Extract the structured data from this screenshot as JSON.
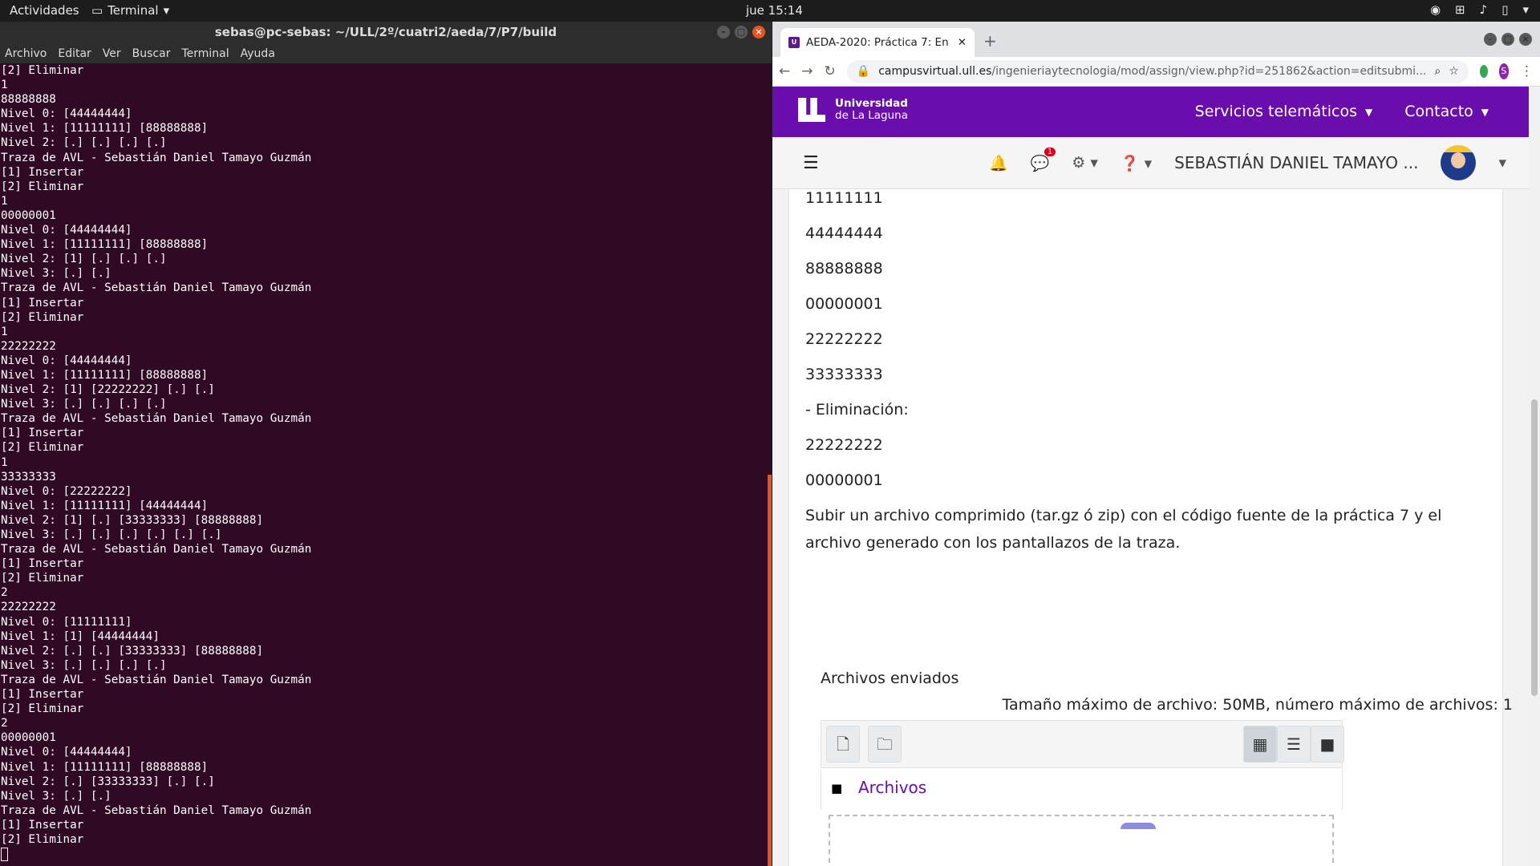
{
  "topbar": {
    "activities": "Actividades",
    "app_name": "Terminal",
    "clock": "jue 15:14"
  },
  "terminal": {
    "title": "sebas@pc-sebas: ~/ULL/2º/cuatri2/aeda/7/P7/build",
    "menu": [
      "Archivo",
      "Editar",
      "Ver",
      "Buscar",
      "Terminal",
      "Ayuda"
    ],
    "lines": [
      "[2] Eliminar",
      "1",
      "88888888",
      "Nivel 0: [44444444]",
      "Nivel 1: [11111111] [88888888]",
      "Nivel 2: [.] [.] [.] [.]",
      "Traza de AVL - Sebastián Daniel Tamayo Guzmán",
      "[1] Insertar",
      "[2] Eliminar",
      "1",
      "00000001",
      "Nivel 0: [44444444]",
      "Nivel 1: [11111111] [88888888]",
      "Nivel 2: [1] [.] [.] [.]",
      "Nivel 3: [.] [.]",
      "Traza de AVL - Sebastián Daniel Tamayo Guzmán",
      "[1] Insertar",
      "[2] Eliminar",
      "1",
      "22222222",
      "Nivel 0: [44444444]",
      "Nivel 1: [11111111] [88888888]",
      "Nivel 2: [1] [22222222] [.] [.]",
      "Nivel 3: [.] [.] [.] [.]",
      "Traza de AVL - Sebastián Daniel Tamayo Guzmán",
      "[1] Insertar",
      "[2] Eliminar",
      "1",
      "33333333",
      "Nivel 0: [22222222]",
      "Nivel 1: [11111111] [44444444]",
      "Nivel 2: [1] [.] [33333333] [88888888]",
      "Nivel 3: [.] [.] [.] [.] [.] [.]",
      "Traza de AVL - Sebastián Daniel Tamayo Guzmán",
      "[1] Insertar",
      "[2] Eliminar",
      "2",
      "22222222",
      "Nivel 0: [11111111]",
      "Nivel 1: [1] [44444444]",
      "Nivel 2: [.] [.] [33333333] [88888888]",
      "Nivel 3: [.] [.] [.] [.]",
      "Traza de AVL - Sebastián Daniel Tamayo Guzmán",
      "[1] Insertar",
      "[2] Eliminar",
      "2",
      "00000001",
      "Nivel 0: [44444444]",
      "Nivel 1: [11111111] [88888888]",
      "Nivel 2: [.] [33333333] [.] [.]",
      "Nivel 3: [.] [.]",
      "Traza de AVL - Sebastián Daniel Tamayo Guzmán",
      "[1] Insertar",
      "[2] Eliminar"
    ]
  },
  "browser": {
    "tab_title": "AEDA-2020: Práctica 7: En",
    "favicon": "ull-favicon",
    "url_host": "campusvirtual.ull.es",
    "url_path": "/ingenieriaytecnologia/mod/assign/view.php?id=251862&action=editsubmi...",
    "profile_initial": "S"
  },
  "site": {
    "logo_line1": "Universidad",
    "logo_line2": "de La Laguna",
    "nav": [
      "Servicios telemáticos",
      "Contacto"
    ],
    "notifications_badge": "1",
    "username": "SEBASTIÁN DANIEL TAMAYO ...",
    "brand_color": "#6a0dad"
  },
  "content": {
    "values": [
      "11111111",
      "44444444",
      "88888888",
      "00000001",
      "22222222",
      "33333333"
    ],
    "elimination_heading": "- Eliminación:",
    "elimination_values": [
      "22222222",
      "00000001"
    ],
    "instructions": "Subir un archivo comprimido (tar.gz ó zip) con el código fuente de la práctica 7 y el archivo generado con los pantallazos de la traza.",
    "files_title": "Archivos enviados",
    "files_limits": "Tamaño máximo de archivo: 50MB, número máximo de archivos: 1",
    "folder_path": "Archivos"
  }
}
